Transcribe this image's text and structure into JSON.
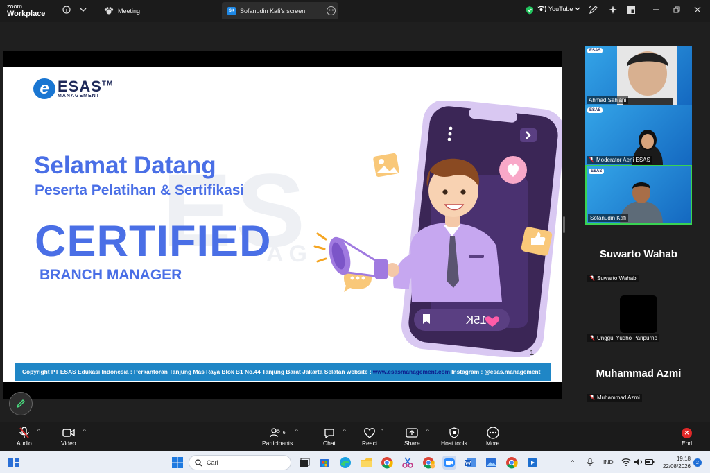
{
  "app": {
    "brand_line1": "zoom",
    "brand_line2": "Workplace"
  },
  "tabs": [
    {
      "label": "Meeting"
    },
    {
      "label": "Sofanudin Kafi's screen",
      "badge": "SK"
    }
  ],
  "topbar": {
    "youtube_label": "YouTube"
  },
  "slide": {
    "logo_name": "ESAS",
    "logo_tm": "TM",
    "logo_sub": "MANAGEMENT",
    "title": "Selamat Datang",
    "subtitle": "Peserta Pelatihan & Sertifikasi",
    "big_word": "CERTIFIED",
    "role": "BRANCH MANAGER",
    "page_number": "1",
    "phone_counter": "15K",
    "footer": {
      "text_before": "Copyright PT ESAS Edukasi Indonesia : Perkantoran Tanjung Mas Raya Blok B1 No.44 Tanjung Barat Jakarta Selatan website :",
      "link": "www.esasmanagement.com",
      "text_after": "Instagram : @esas.management"
    }
  },
  "participants": {
    "tiles": [
      {
        "name": "Ahmad Sahlani",
        "logo": "ESAS"
      },
      {
        "name": "Moderator Aeni ESAS",
        "logo": "ESAS"
      },
      {
        "name": "Sofanudin Kafi",
        "logo": "ESAS"
      }
    ],
    "no_video": [
      {
        "display": "Suwarto Wahab",
        "label": "Suwarto Wahab"
      },
      {
        "display": "",
        "label": "Unggul Yudho Paripurno"
      },
      {
        "display": "Muhammad Azmi",
        "label": "Muhammad Azmi"
      }
    ]
  },
  "toolbar": {
    "audio": "Audio",
    "video": "Video",
    "participants": "Participants",
    "participants_count": "6",
    "chat": "Chat",
    "react": "React",
    "share": "Share",
    "host_tools": "Host tools",
    "more": "More",
    "end": "End"
  },
  "taskbar": {
    "search_placeholder": "Cari",
    "language": "IND",
    "time": "19.18",
    "date": "22/08/2026",
    "notifications": "2"
  },
  "colors": {
    "accent_blue": "#4a6fe6",
    "footer_blue": "#1f86c6",
    "end_red": "#e02828",
    "active_border": "#39d353"
  }
}
